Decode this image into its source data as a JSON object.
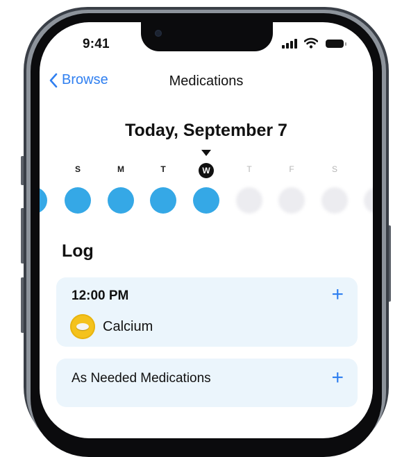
{
  "status_bar": {
    "time": "9:41"
  },
  "nav": {
    "back_label": "Browse",
    "title": "Medications"
  },
  "date_heading": "Today, September 7",
  "week": {
    "days": [
      {
        "letter": "S",
        "state": "logged"
      },
      {
        "letter": "M",
        "state": "logged"
      },
      {
        "letter": "T",
        "state": "logged"
      },
      {
        "letter": "W",
        "state": "today"
      },
      {
        "letter": "T",
        "state": "future"
      },
      {
        "letter": "F",
        "state": "future"
      },
      {
        "letter": "S",
        "state": "future"
      }
    ]
  },
  "log": {
    "heading": "Log",
    "scheduled": {
      "time": "12:00 PM",
      "add_icon": "plus-icon",
      "medications": [
        {
          "name": "Calcium",
          "icon": "pill-icon",
          "color": "#f4c21c"
        }
      ]
    },
    "as_needed": {
      "label": "As Needed Medications",
      "add_icon": "plus-icon"
    }
  },
  "colors": {
    "accent": "#2f7ff0",
    "logged_dot": "#35a8e6",
    "card_background": "#ebf5fc"
  }
}
